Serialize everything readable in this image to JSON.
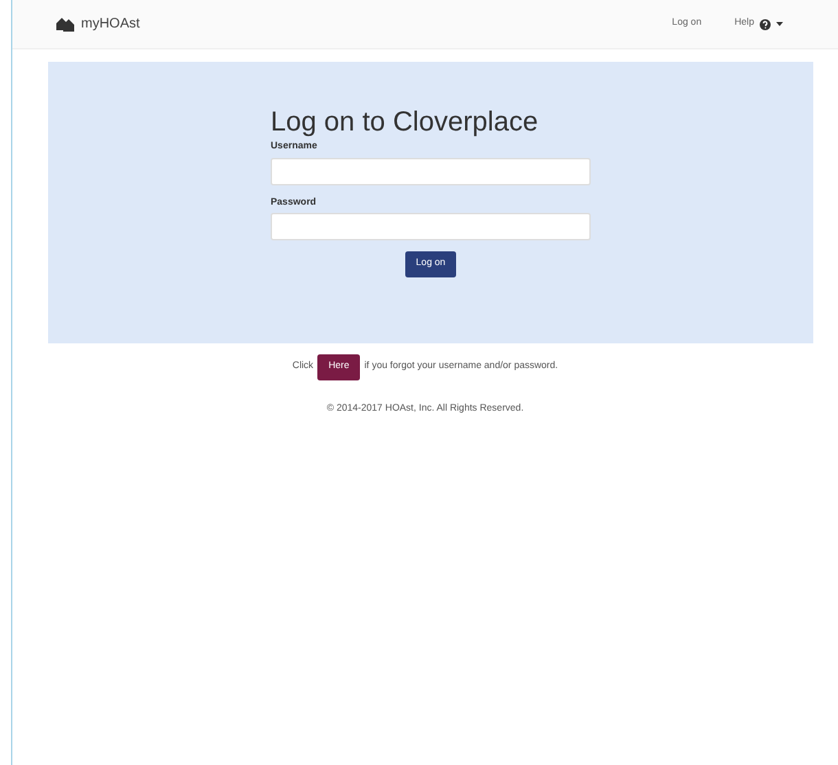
{
  "navbar": {
    "brand": "myHOAst",
    "links": [
      {
        "kind": "link",
        "label": "Log on"
      },
      {
        "kind": "dropdown",
        "label": "Help"
      }
    ]
  },
  "login": {
    "title": "Log on to Cloverplace",
    "fields": [
      {
        "label": "Username"
      },
      {
        "label": "Password"
      }
    ],
    "button": "Log on"
  },
  "forgot": {
    "before": "Click",
    "button": "Here",
    "after": "if you forgot your username and/or password."
  },
  "footer": "© 2014-2017 HOAst, Inc. All Rights Reserved."
}
